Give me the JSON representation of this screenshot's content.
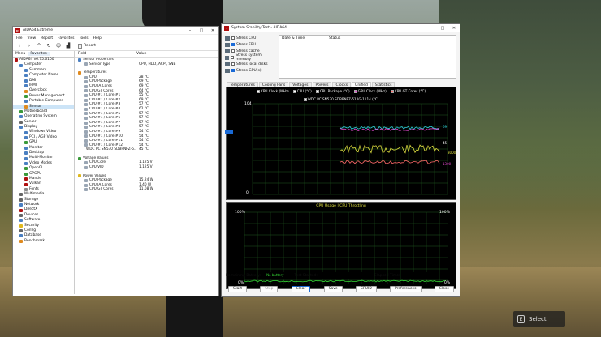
{
  "aida": {
    "title": "AIDA64 Extreme",
    "icon_text": "64",
    "menu": [
      "File",
      "View",
      "Report",
      "Favorites",
      "Tools",
      "Help"
    ],
    "toolbar_report": "Report",
    "tabs": [
      "Menu",
      "Favorites"
    ],
    "tree": [
      {
        "label": "AIDA64 v6.75.6100",
        "indent": 0,
        "color": "#b01010"
      },
      {
        "label": "Computer",
        "indent": 1,
        "color": "#4a7fc1"
      },
      {
        "label": "Summary",
        "indent": 2,
        "color": "#4a7fc1"
      },
      {
        "label": "Computer Name",
        "indent": 2,
        "color": "#4a7fc1"
      },
      {
        "label": "DMI",
        "indent": 2,
        "color": "#4a7fc1"
      },
      {
        "label": "IPMI",
        "indent": 2,
        "color": "#4a7fc1"
      },
      {
        "label": "Overclock",
        "indent": 2,
        "color": "#e08a1e"
      },
      {
        "label": "Power Management",
        "indent": 2,
        "color": "#3a9a3a"
      },
      {
        "label": "Portable Computer",
        "indent": 2,
        "color": "#4a7fc1"
      },
      {
        "label": "Sensor",
        "indent": 2,
        "color": "#e08a1e",
        "selected": true
      },
      {
        "label": "Motherboard",
        "indent": 1,
        "color": "#3a9a3a"
      },
      {
        "label": "Operating System",
        "indent": 1,
        "color": "#4a7fc1"
      },
      {
        "label": "Server",
        "indent": 1,
        "color": "#666"
      },
      {
        "label": "Display",
        "indent": 1,
        "color": "#4a7fc1"
      },
      {
        "label": "Windows Video",
        "indent": 2,
        "color": "#4a7fc1"
      },
      {
        "label": "PCI / AGP Video",
        "indent": 2,
        "color": "#4a7fc1"
      },
      {
        "label": "GPU",
        "indent": 2,
        "color": "#3a9a3a"
      },
      {
        "label": "Monitor",
        "indent": 2,
        "color": "#4a7fc1"
      },
      {
        "label": "Desktop",
        "indent": 2,
        "color": "#4a7fc1"
      },
      {
        "label": "Multi-Monitor",
        "indent": 2,
        "color": "#4a7fc1"
      },
      {
        "label": "Video Modes",
        "indent": 2,
        "color": "#4a7fc1"
      },
      {
        "label": "OpenGL",
        "indent": 2,
        "color": "#3a9a3a"
      },
      {
        "label": "GPGPU",
        "indent": 2,
        "color": "#3a9a3a"
      },
      {
        "label": "Mantle",
        "indent": 2,
        "color": "#b01010"
      },
      {
        "label": "Vulkan",
        "indent": 2,
        "color": "#b01010"
      },
      {
        "label": "Fonts",
        "indent": 2,
        "color": "#888"
      },
      {
        "label": "Multimedia",
        "indent": 1,
        "color": "#666"
      },
      {
        "label": "Storage",
        "indent": 1,
        "color": "#666"
      },
      {
        "label": "Network",
        "indent": 1,
        "color": "#4a7fc1"
      },
      {
        "label": "DirectX",
        "indent": 1,
        "color": "#b01010"
      },
      {
        "label": "Devices",
        "indent": 1,
        "color": "#666"
      },
      {
        "label": "Software",
        "indent": 1,
        "color": "#4a7fc1"
      },
      {
        "label": "Security",
        "indent": 1,
        "color": "#e0b81e"
      },
      {
        "label": "Config",
        "indent": 1,
        "color": "#666"
      },
      {
        "label": "Database",
        "indent": 1,
        "color": "#4a7fc1"
      },
      {
        "label": "Benchmark",
        "indent": 1,
        "color": "#e08a1e"
      }
    ],
    "columns": [
      "Field",
      "Value"
    ],
    "sections": [
      {
        "title": "Sensor Properties",
        "rows": [
          {
            "field": "Sensor Type",
            "value": "CPU, HDD, ACPI, SNB"
          }
        ]
      },
      {
        "title": "Temperatures",
        "rows": [
          {
            "field": "CPU",
            "value": "28 °C"
          },
          {
            "field": "CPU Package",
            "value": "69 °C"
          },
          {
            "field": "CPU IA Cores",
            "value": "69 °C"
          },
          {
            "field": "CPU GT Cores",
            "value": "64 °C"
          },
          {
            "field": "CPU #1 / Core #1",
            "value": "55 °C"
          },
          {
            "field": "CPU #1 / Core #2",
            "value": "69 °C"
          },
          {
            "field": "CPU #1 / Core #3",
            "value": "57 °C"
          },
          {
            "field": "CPU #1 / Core #4",
            "value": "62 °C"
          },
          {
            "field": "CPU #1 / Core #5",
            "value": "57 °C"
          },
          {
            "field": "CPU #1 / Core #6",
            "value": "57 °C"
          },
          {
            "field": "CPU #1 / Core #7",
            "value": "57 °C"
          },
          {
            "field": "CPU #1 / Core #8",
            "value": "57 °C"
          },
          {
            "field": "CPU #1 / Core #9",
            "value": "54 °C"
          },
          {
            "field": "CPU #1 / Core #10",
            "value": "54 °C"
          },
          {
            "field": "CPU #1 / Core #11",
            "value": "54 °C"
          },
          {
            "field": "CPU #1 / Core #12",
            "value": "54 °C"
          },
          {
            "field": "WDC PC SN530 SDBPNPZ-5...",
            "value": "45 °C"
          }
        ]
      },
      {
        "title": "Voltage Values",
        "rows": [
          {
            "field": "CPU Core",
            "value": "1.125 V"
          },
          {
            "field": "CPU VID",
            "value": "1.125 V"
          }
        ]
      },
      {
        "title": "Power Values",
        "rows": [
          {
            "field": "CPU Package",
            "value": "15.24 W"
          },
          {
            "field": "CPU IA Cores",
            "value": "1.40 W"
          },
          {
            "field": "CPU GT Cores",
            "value": "11.08 W"
          }
        ]
      }
    ]
  },
  "sst": {
    "title": "System Stability Test - AIDA64",
    "stress": [
      {
        "label": "Stress CPU",
        "checked": false
      },
      {
        "label": "Stress FPU",
        "checked": true
      },
      {
        "label": "Stress cache",
        "checked": false
      },
      {
        "label": "Stress system memory",
        "checked": false
      },
      {
        "label": "Stress local disks",
        "checked": false
      },
      {
        "label": "Stress GPU(s)",
        "checked": true
      }
    ],
    "status_cols": [
      "Date & Time",
      "Status"
    ],
    "tabs": [
      "Temperatures",
      "Cooling Fans",
      "Voltages",
      "Powers",
      "Clocks",
      "Unified",
      "Statistics"
    ],
    "active_tab": "Unified",
    "legend1": [
      {
        "label": "CPU Clock (MHz)",
        "color": "#ffffff"
      },
      {
        "label": "CPU (°C)",
        "color": "#ffffff"
      },
      {
        "label": "CPU Package (°C)",
        "color": "#ffffff"
      },
      {
        "label": "GPU Clock (MHz)",
        "color": "#e64ad1"
      },
      {
        "label": "CPU GT Cores (°C)",
        "color": "#ff6a6a"
      },
      {
        "label": "WDC PC SN530 SDBPNPZ-512G-1114 (°C)",
        "color": "#ffffff"
      }
    ],
    "graph1": {
      "ymax_label": "104",
      "ymin_label": "0",
      "right_labels": [
        "69",
        "45",
        "3000",
        "1300"
      ]
    },
    "legend2": "CPU Usage | CPU Throttling",
    "graph2": {
      "ymax_label": "100%",
      "ymin_label": "0%",
      "right_top": "100%",
      "right_bottom": "0%"
    },
    "battery_label": "Remaining Battery:",
    "battery_value": "No battery",
    "test_started_label": "Test Started:",
    "elapsed_label": "Elapsed Time:",
    "buttons": [
      "Start",
      "Stop",
      "Clear",
      "Save",
      "CPUID",
      "Preferences",
      "Close"
    ]
  },
  "hint": {
    "key": "E",
    "label": "Select"
  }
}
